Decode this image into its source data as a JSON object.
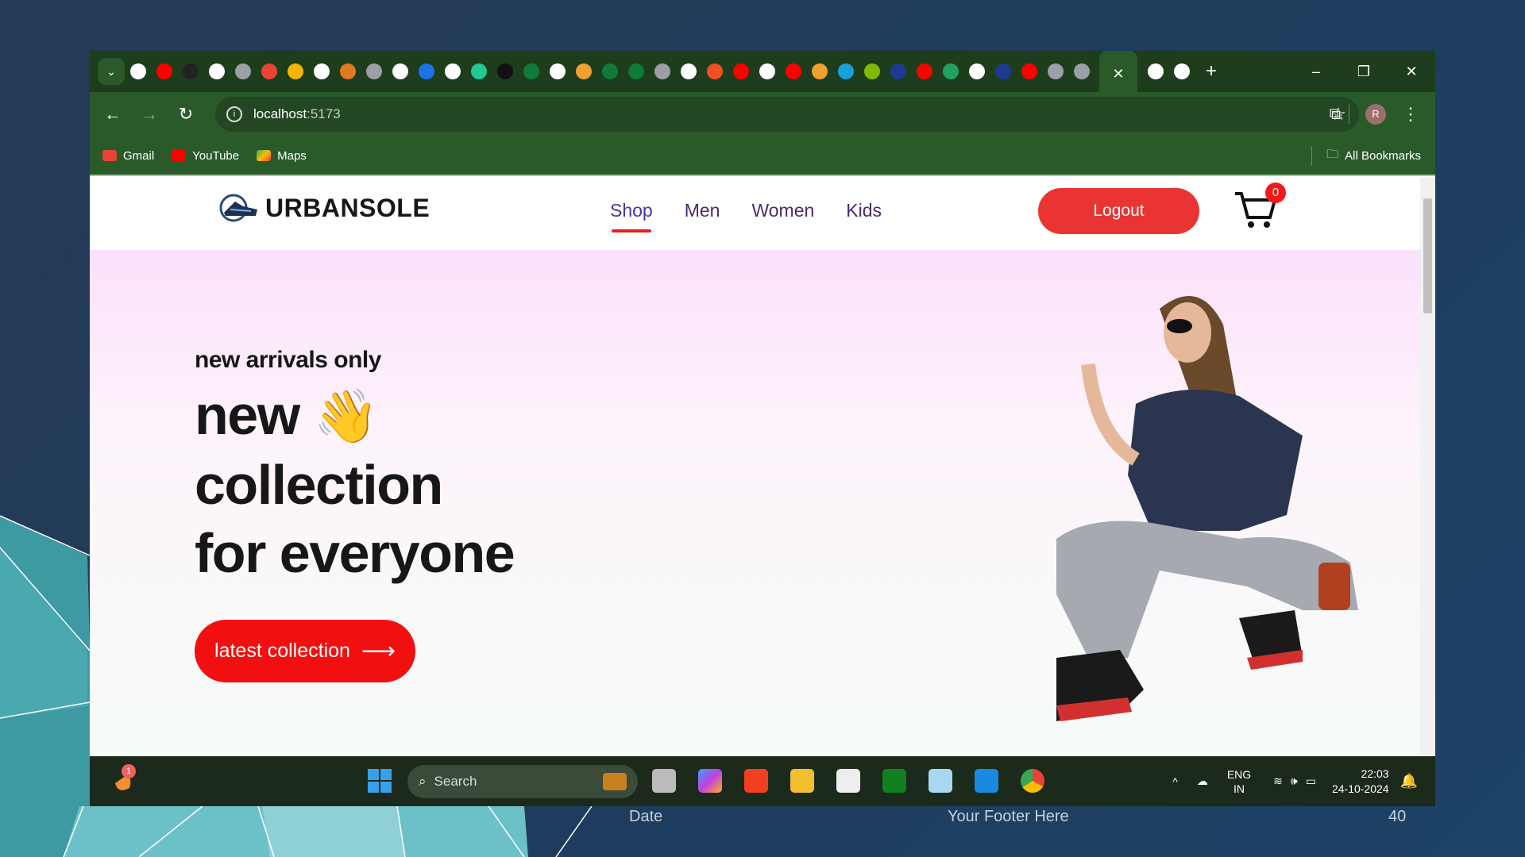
{
  "browser": {
    "url_host": "localhost",
    "url_port": ":5173",
    "window_controls": [
      "–",
      "❐",
      "✕"
    ],
    "new_tab": "+",
    "tab_close": "✕",
    "tab_icon_colors": [
      "#ffffff",
      "#ff0000",
      "#222222",
      "#ffffff",
      "#9aa0a6",
      "#ea4335",
      "#f4b400",
      "#ffffff",
      "#e07a1f",
      "#9aa0a6",
      "#ffffff",
      "#1a73e8",
      "#ffffff",
      "#20c997",
      "#111111",
      "#0f7a3a",
      "#ffffff",
      "#f0a030",
      "#0f7a3a",
      "#0f7a3a",
      "#9aa0a6",
      "#ffffff",
      "#f25022",
      "#ff0000",
      "#ffffff",
      "#ff0000",
      "#f0a030",
      "#1aa0d8",
      "#7fba00",
      "#1f3a93",
      "#ff0000",
      "#1fa463",
      "#ffffff",
      "#1f3a93",
      "#ff0000",
      "#9aa0a6",
      "#9aa0a6"
    ],
    "after_tab_icon_colors": [
      "#ffffff",
      "#ffffff"
    ],
    "profile_initial": "R",
    "bookmarks": [
      {
        "label": "Gmail",
        "color": "#ea4335"
      },
      {
        "label": "YouTube",
        "color": "#ff0000"
      },
      {
        "label": "Maps",
        "color": "#34a853"
      }
    ],
    "all_bookmarks": "All Bookmarks"
  },
  "site": {
    "logo": "URBANSOLE",
    "nav": [
      "Shop",
      "Men",
      "Women",
      "Kids"
    ],
    "logout": "Logout",
    "cart_count": "0",
    "hero": {
      "tag": "new arrivals only",
      "line1": "new",
      "emoji": "👋",
      "line2": "collection",
      "line3": "for everyone",
      "cta": "latest collection",
      "cta_arrow": "⟶"
    }
  },
  "taskbar": {
    "search": "Search",
    "lang1": "ENG",
    "lang2": "IN",
    "time": "22:03",
    "date": "24-10-2024",
    "widget_badge": "1"
  },
  "slide_footer": {
    "date": "Date",
    "text": "Your Footer Here",
    "page": "40"
  }
}
